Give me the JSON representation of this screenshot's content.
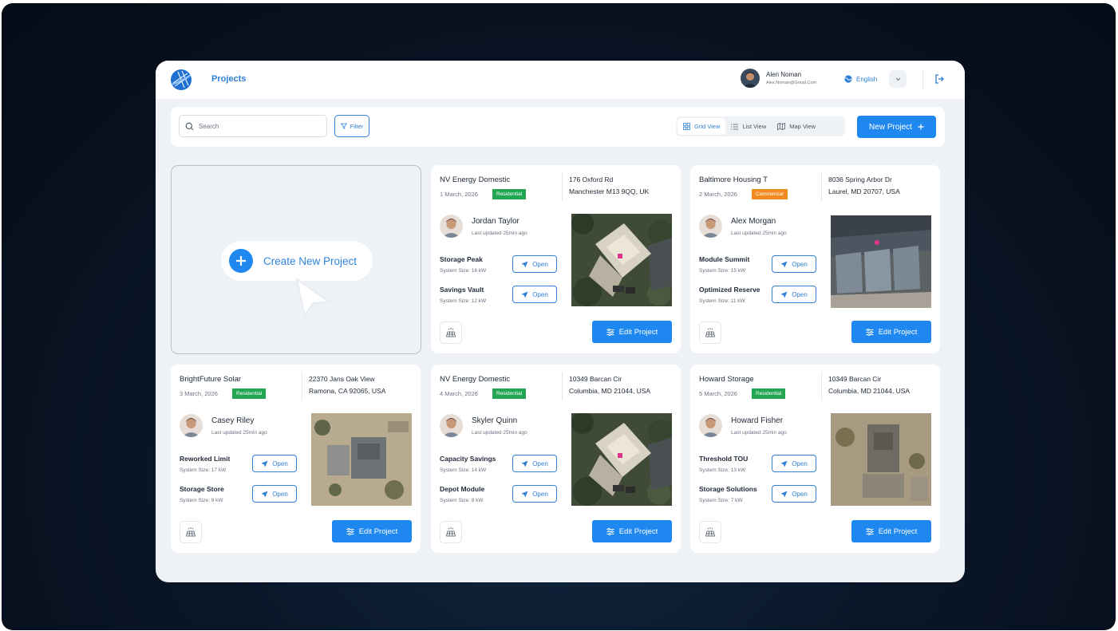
{
  "header": {
    "title": "Projects",
    "user_name": "Alen Noman",
    "user_email": "Alex.Noman@Gmail.Com",
    "language": "English"
  },
  "toolbar": {
    "search_placeholder": "Search",
    "filter_label": "Filter",
    "views": [
      {
        "label": "Grid View",
        "icon": "grid-icon",
        "active": true
      },
      {
        "label": "List View",
        "icon": "list-icon",
        "active": false
      },
      {
        "label": "Map View",
        "icon": "map-icon",
        "active": false
      }
    ],
    "new_project_label": "New Project"
  },
  "create_card": {
    "label": "Create New Project"
  },
  "projects": [
    {
      "title": "NV Energy Domestic",
      "date": "1 March, 2026",
      "tag": "Residential",
      "tag_type": "res",
      "address_line1": "176 Oxford Rd",
      "address_line2": "Manchester M13 9QQ, UK",
      "person": "Jordan Taylor",
      "updated": "Last updated 25min ago",
      "systems": [
        {
          "name": "Storage Peak",
          "size": "System Size: 16 kW",
          "action": "Open"
        },
        {
          "name": "Savings Vault",
          "size": "System Size: 12 kW",
          "action": "Open"
        }
      ],
      "edit_label": "Edit Project"
    },
    {
      "title": "Baltimore Housing T",
      "date": "2 March, 2026",
      "tag": "Commercial",
      "tag_type": "com",
      "address_line1": "8036 Spring Arbor Dr",
      "address_line2": "Laurel, MD 20707, USA",
      "person": "Alex Morgan",
      "updated": "Last updated 25min ago",
      "systems": [
        {
          "name": "Module Summit",
          "size": "System Size: 15 kW",
          "action": "Open"
        },
        {
          "name": "Optimized Reserve",
          "size": "System Size: 11 kW",
          "action": "Open"
        }
      ],
      "edit_label": "Edit Project"
    },
    {
      "title": "BrightFuture Solar",
      "date": "3 March, 2026",
      "tag": "Residential",
      "tag_type": "res",
      "address_line1": "22370 Jans Oak View",
      "address_line2": "Ramona, CA 92065, USA",
      "person": "Casey Riley",
      "updated": "Last updated 25min ago",
      "systems": [
        {
          "name": "Reworked Limit",
          "size": "System Size: 17 kW",
          "action": "Open"
        },
        {
          "name": "Storage Store",
          "size": "System Size: 9 kW",
          "action": "Open"
        }
      ],
      "edit_label": "Edit Project"
    },
    {
      "title": "NV Energy Domestic",
      "date": "4 March, 2026",
      "tag": "Residential",
      "tag_type": "res",
      "address_line1": "10349 Barcan Cir",
      "address_line2": "Columbia, MD 21044, USA",
      "person": "Skyler Quinn",
      "updated": "Last updated 25min ago",
      "systems": [
        {
          "name": "Capacity Savings",
          "size": "System Size: 14 kW",
          "action": "Open"
        },
        {
          "name": "Depot Module",
          "size": "System Size: 8 kW",
          "action": "Open"
        }
      ],
      "edit_label": "Edit Project"
    },
    {
      "title": "Howard Storage",
      "date": "5 March, 2026",
      "tag": "Residential",
      "tag_type": "res",
      "address_line1": "10349 Barcan Cir",
      "address_line2": "Columbia, MD 21044, USA",
      "person": "Howard Fisher",
      "updated": "Last updated 25min ago",
      "systems": [
        {
          "name": "Threshold TOU",
          "size": "System Size: 13 kW",
          "action": "Open"
        },
        {
          "name": "Storage Solutions",
          "size": "System Size: 7 kW",
          "action": "Open"
        }
      ],
      "edit_label": "Edit Project"
    }
  ]
}
